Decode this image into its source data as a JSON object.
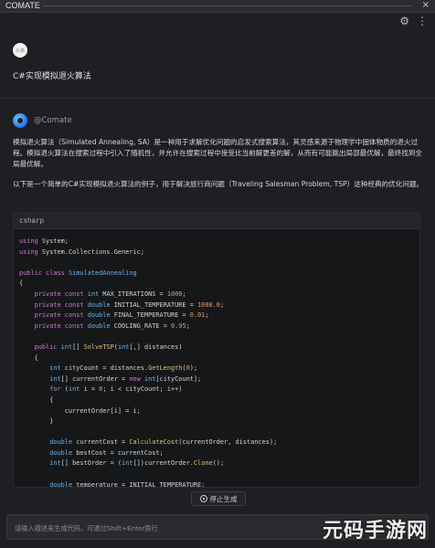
{
  "window": {
    "title": "COMATE",
    "close_glyph": "×"
  },
  "toolbar": {
    "settings_icon": "gear-icon",
    "settings_glyph": "⚙",
    "more_icon": "more-icon",
    "more_glyph": "⋮"
  },
  "user": {
    "avatar_text": "头像",
    "message": "C#实现模拟退火算法"
  },
  "bot": {
    "name": "@Comate",
    "paragraph1": "模拟退火算法（Simulated Annealing, SA）是一种用于求解优化问题的启发式搜索算法，其灵感来源于物理学中固体物质的退火过程。模拟退火算法在搜索过程中引入了随机性，并允许在搜索过程中接受比当前解更差的解，从而有可能跳出局部最优解，最终找到全局最优解。",
    "paragraph2": "以下是一个简单的C#实现模拟退火算法的例子，用于解决旅行商问题（Traveling Salesman Problem, TSP）这种经典的优化问题。"
  },
  "code": {
    "language": "csharp",
    "lines": [
      [
        [
          "kw",
          "using"
        ],
        [
          "txt",
          " System;"
        ]
      ],
      [
        [
          "kw",
          "using"
        ],
        [
          "txt",
          " System.Collections.Generic;"
        ]
      ],
      [],
      [
        [
          "kw",
          "public class"
        ],
        [
          "txt",
          " "
        ],
        [
          "ty",
          "SimulatedAnnealing"
        ]
      ],
      [
        [
          "txt",
          "{"
        ]
      ],
      [
        [
          "txt",
          "    "
        ],
        [
          "kw",
          "private const"
        ],
        [
          "txt",
          " "
        ],
        [
          "ty",
          "int"
        ],
        [
          "txt",
          " MAX_ITERATIONS = "
        ],
        [
          "num",
          "1000"
        ],
        [
          "txt",
          ";"
        ]
      ],
      [
        [
          "txt",
          "    "
        ],
        [
          "kw",
          "private const"
        ],
        [
          "txt",
          " "
        ],
        [
          "ty",
          "double"
        ],
        [
          "txt",
          " INITIAL_TEMPERATURE = "
        ],
        [
          "num",
          "1000.0"
        ],
        [
          "txt",
          ";"
        ]
      ],
      [
        [
          "txt",
          "    "
        ],
        [
          "kw",
          "private const"
        ],
        [
          "txt",
          " "
        ],
        [
          "ty",
          "double"
        ],
        [
          "txt",
          " FINAL_TEMPERATURE = "
        ],
        [
          "num",
          "0.01"
        ],
        [
          "txt",
          ";"
        ]
      ],
      [
        [
          "txt",
          "    "
        ],
        [
          "kw",
          "private const"
        ],
        [
          "txt",
          " "
        ],
        [
          "ty",
          "double"
        ],
        [
          "txt",
          " COOLING_RATE = "
        ],
        [
          "num",
          "0.95"
        ],
        [
          "txt",
          ";"
        ]
      ],
      [],
      [
        [
          "txt",
          "    "
        ],
        [
          "kw",
          "public"
        ],
        [
          "txt",
          " "
        ],
        [
          "ty",
          "int"
        ],
        [
          "txt",
          "[] "
        ],
        [
          "fn",
          "SolveTSP"
        ],
        [
          "txt",
          "("
        ],
        [
          "ty",
          "int"
        ],
        [
          "txt",
          "[,] distances)"
        ]
      ],
      [
        [
          "txt",
          "    {"
        ]
      ],
      [
        [
          "txt",
          "        "
        ],
        [
          "ty",
          "int"
        ],
        [
          "txt",
          " cityCount = distances."
        ],
        [
          "fn",
          "GetLength"
        ],
        [
          "txt",
          "("
        ],
        [
          "num",
          "0"
        ],
        [
          "txt",
          ");"
        ]
      ],
      [
        [
          "txt",
          "        "
        ],
        [
          "ty",
          "int"
        ],
        [
          "txt",
          "[] currentOrder = "
        ],
        [
          "kw",
          "new"
        ],
        [
          "txt",
          " "
        ],
        [
          "ty",
          "int"
        ],
        [
          "txt",
          "[cityCount];"
        ]
      ],
      [
        [
          "txt",
          "        "
        ],
        [
          "kw",
          "for"
        ],
        [
          "txt",
          " ("
        ],
        [
          "ty",
          "int"
        ],
        [
          "txt",
          " i = "
        ],
        [
          "num",
          "0"
        ],
        [
          "txt",
          "; i < cityCount; i++)"
        ]
      ],
      [
        [
          "txt",
          "        {"
        ]
      ],
      [
        [
          "txt",
          "            currentOrder[i] = i;"
        ]
      ],
      [
        [
          "txt",
          "        }"
        ]
      ],
      [],
      [
        [
          "txt",
          "        "
        ],
        [
          "ty",
          "double"
        ],
        [
          "txt",
          " currentCost = "
        ],
        [
          "fn",
          "CalculateCost"
        ],
        [
          "txt",
          "(currentOrder, distances);"
        ]
      ],
      [
        [
          "txt",
          "        "
        ],
        [
          "ty",
          "double"
        ],
        [
          "txt",
          " bestCost = currentCost;"
        ]
      ],
      [
        [
          "txt",
          "        "
        ],
        [
          "ty",
          "int"
        ],
        [
          "txt",
          "[] bestOrder = ("
        ],
        [
          "ty",
          "int"
        ],
        [
          "txt",
          "[])currentOrder."
        ],
        [
          "fn",
          "Clone"
        ],
        [
          "txt",
          "();"
        ]
      ],
      [],
      [
        [
          "txt",
          "        "
        ],
        [
          "ty",
          "double"
        ],
        [
          "txt",
          " temperature = INITIAL_TEMPERATURE;"
        ]
      ]
    ]
  },
  "stop_button": {
    "label": "停止生成"
  },
  "input": {
    "placeholder": "请输入描述来生成代码，可通过Shift+Enter换行"
  },
  "watermark": {
    "text": "元码手游网"
  }
}
